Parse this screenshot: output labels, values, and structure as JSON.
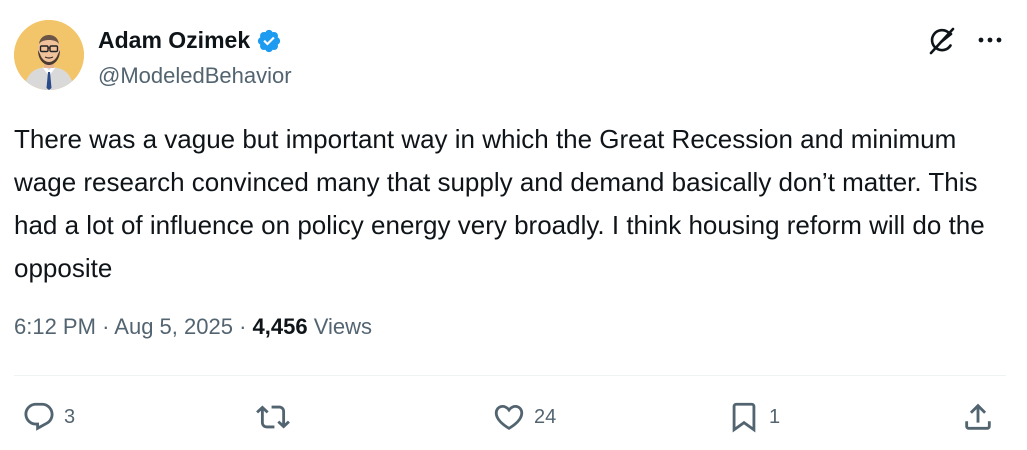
{
  "author": {
    "name": "Adam Ozimek",
    "handle": "@ModeledBehavior",
    "verified": true,
    "verified_color": "#1d9bf0"
  },
  "header_icons": [
    "grok-icon",
    "more-options-icon"
  ],
  "tweet": {
    "text": "There was a vague but important way in which the Great Recession and minimum wage research convinced many that supply and demand basically don’t matter. This had a lot of influence on policy energy very broadly. I think housing reform will do the opposite"
  },
  "meta": {
    "time": "6:12 PM",
    "separator": "·",
    "date": "Aug 5, 2025",
    "views_count": "4,456",
    "views_label": "Views"
  },
  "actions": {
    "reply_count": "3",
    "repost_count": "",
    "like_count": "24",
    "bookmark_count": "1"
  },
  "colors": {
    "text_primary": "#0f1419",
    "text_secondary": "#536471",
    "divider": "#eff3f4",
    "avatar_bg": "#f3c56a"
  }
}
